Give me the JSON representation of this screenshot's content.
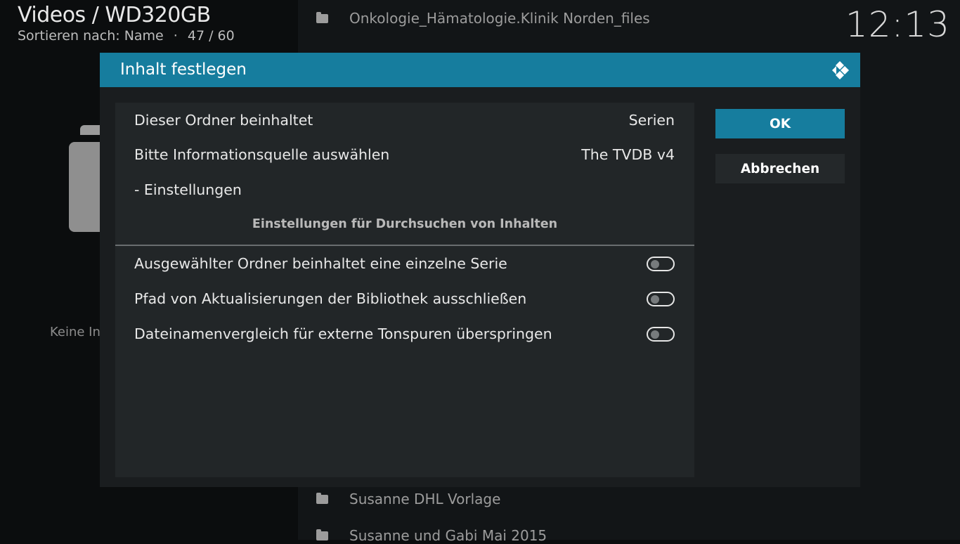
{
  "header": {
    "title": "Videos / WD320GB",
    "sort_label": "Sortieren nach: Name",
    "separator": "·",
    "position": "47 / 60",
    "clock": "12:13"
  },
  "background": {
    "list_items": [
      "Onkologie_Hämatologie.Klinik Norden_files",
      "Susanne DHL Vorlage",
      "Susanne und Gabi Mai 2015"
    ],
    "info_text_partial": "Keine In"
  },
  "dialog": {
    "title": "Inhalt festlegen",
    "rows": {
      "content_type": {
        "label": "Dieser Ordner beinhaltet",
        "value": "Serien"
      },
      "scraper": {
        "label": "Bitte Informationsquelle auswählen",
        "value": "The TVDB v4"
      },
      "settings": {
        "label": "- Einstellungen"
      }
    },
    "section_title": "Einstellungen für Durchsuchen von Inhalten",
    "toggles": [
      {
        "label": "Ausgewählter Ordner beinhaltet eine einzelne Serie",
        "state": "off"
      },
      {
        "label": "Pfad von Aktualisierungen der Bibliothek ausschließen",
        "state": "off"
      },
      {
        "label": "Dateinamenvergleich für externe Tonspuren überspringen",
        "state": "off"
      }
    ],
    "buttons": {
      "ok": "OK",
      "cancel": "Abbrechen"
    }
  },
  "colors": {
    "accent": "#167d9e",
    "dialog_bg": "#1a1d1f",
    "panel_bg": "#222628"
  }
}
